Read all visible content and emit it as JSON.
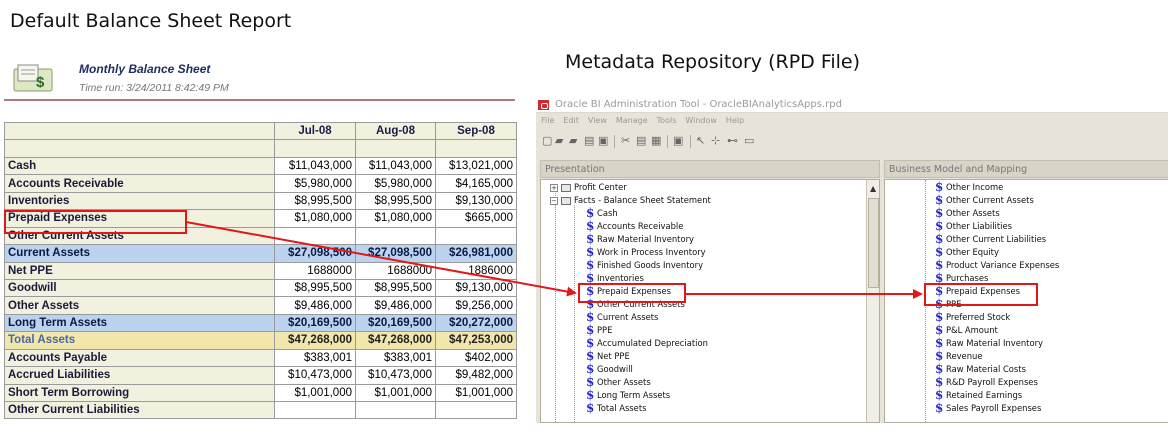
{
  "left_heading": "Default Balance Sheet Report",
  "right_heading": "Metadata Repository (RPD File)",
  "report": {
    "title": "Monthly Balance Sheet",
    "time_run": "Time run: 3/24/2011 8:42:49 PM",
    "columns": [
      "Jul-08",
      "Aug-08",
      "Sep-08"
    ],
    "rows": [
      {
        "label": "Cash",
        "values": [
          "$11,043,000",
          "$11,043,000",
          "$13,021,000"
        ]
      },
      {
        "label": "Accounts Receivable",
        "values": [
          "$5,980,000",
          "$5,980,000",
          "$4,165,000"
        ]
      },
      {
        "label": "Inventories",
        "values": [
          "$8,995,500",
          "$8,995,500",
          "$9,130,000"
        ]
      },
      {
        "label": "Prepaid Expenses",
        "values": [
          "$1,080,000",
          "$1,080,000",
          "$665,000"
        ]
      },
      {
        "label": "Other Current Assets",
        "values": [
          "",
          "",
          ""
        ]
      },
      {
        "label": "Current Assets",
        "values": [
          "$27,098,500",
          "$27,098,500",
          "$26,981,000"
        ]
      },
      {
        "label": "Net PPE",
        "values": [
          "1688000",
          "1688000",
          "1886000"
        ]
      },
      {
        "label": "Goodwill",
        "values": [
          "$8,995,500",
          "$8,995,500",
          "$9,130,000"
        ]
      },
      {
        "label": "Other Assets",
        "values": [
          "$9,486,000",
          "$9,486,000",
          "$9,256,000"
        ]
      },
      {
        "label": "Long Term Assets",
        "values": [
          "$20,169,500",
          "$20,169,500",
          "$20,272,000"
        ]
      },
      {
        "label": "Total Assets",
        "values": [
          "$47,268,000",
          "$47,268,000",
          "$47,253,000"
        ]
      },
      {
        "label": "Accounts Payable",
        "values": [
          "$383,001",
          "$383,001",
          "$402,000"
        ]
      },
      {
        "label": "Accrued Liabilities",
        "values": [
          "$10,473,000",
          "$10,473,000",
          "$9,482,000"
        ]
      },
      {
        "label": "Short Term Borrowing",
        "values": [
          "$1,001,000",
          "$1,001,000",
          "$1,001,000"
        ]
      },
      {
        "label": "Other Current Liabilities",
        "values": [
          "",
          "",
          ""
        ]
      }
    ]
  },
  "admin_tool": {
    "window_title": "Oracle BI Administration Tool - OracleBIAnalyticsApps.rpd",
    "menu": [
      "File",
      "Edit",
      "View",
      "Manage",
      "Tools",
      "Window",
      "Help"
    ],
    "presentation_title": "Presentation",
    "bmm_title": "Business Model and Mapping",
    "presentation_items": [
      "Profit Center",
      "Facts - Balance Sheet Statement",
      "Cash",
      "Accounts Receivable",
      "Raw Material Inventory",
      "Work in Process Inventory",
      "Finished Goods Inventory",
      "Inventories",
      "Prepaid Expenses",
      "Other Current Assets",
      "Current Assets",
      "PPE",
      "Accumulated Depreciation",
      "Net PPE",
      "Goodwill",
      "Other Assets",
      "Long Term Assets",
      "Total Assets"
    ],
    "bmm_items": [
      "Other Income",
      "Other Current Assets",
      "Other Assets",
      "Other Liabilities",
      "Other Current Liabilities",
      "Other Equity",
      "Product Variance Expenses",
      "Purchases",
      "Prepaid Expenses",
      "PPE",
      "Preferred Stock",
      "P&L Amount",
      "Raw Material Inventory",
      "Revenue",
      "Raw Material Costs",
      "R&D Payroll Expenses",
      "Retained Earnings",
      "Sales Payroll Expenses"
    ]
  },
  "colors": {
    "highlight": "#e21818",
    "subtotal_row": "#bcd3ef",
    "total_row": "#f1e6ab",
    "label_bg": "#f2f0df"
  },
  "icons": [
    "report-icon",
    "dollar-icon",
    "folder-icon",
    "expand-icon"
  ]
}
